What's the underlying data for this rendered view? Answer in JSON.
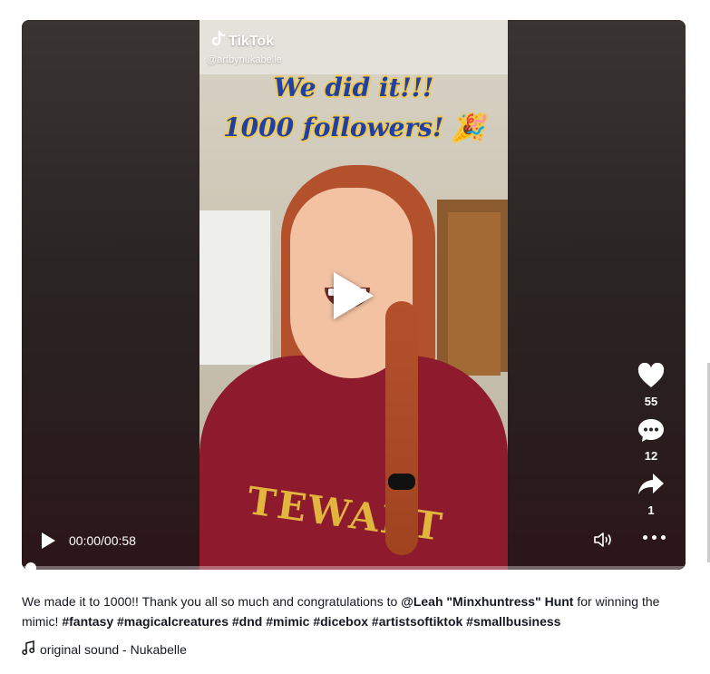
{
  "video": {
    "brand": "TikTok",
    "handle": "@artbynukabelle",
    "overlay_line1": "We did it!!!",
    "overlay_line2": "1000 followers! 🎉",
    "shirt_text": "TEWART",
    "time": "00:00/00:58",
    "progress": 0.0
  },
  "actions": {
    "likes": "55",
    "comments": "12",
    "shares": "1"
  },
  "caption": {
    "text_before": "We made it to 1000!! Thank you all so much and congratulations to ",
    "mention": "@Leah \"Minxhuntress\" Hunt",
    "text_after": " for winning the mimic! ",
    "hashtags": "#fantasy #magicalcreatures #dnd #mimic #dicebox #artistsoftiktok #smallbusiness"
  },
  "sound": {
    "label": "original sound - Nukabelle"
  },
  "icons": [
    "tiktok-logo-icon",
    "play-icon",
    "heart-icon",
    "comment-icon",
    "share-icon",
    "volume-icon",
    "more-icon",
    "music-note-icon"
  ]
}
